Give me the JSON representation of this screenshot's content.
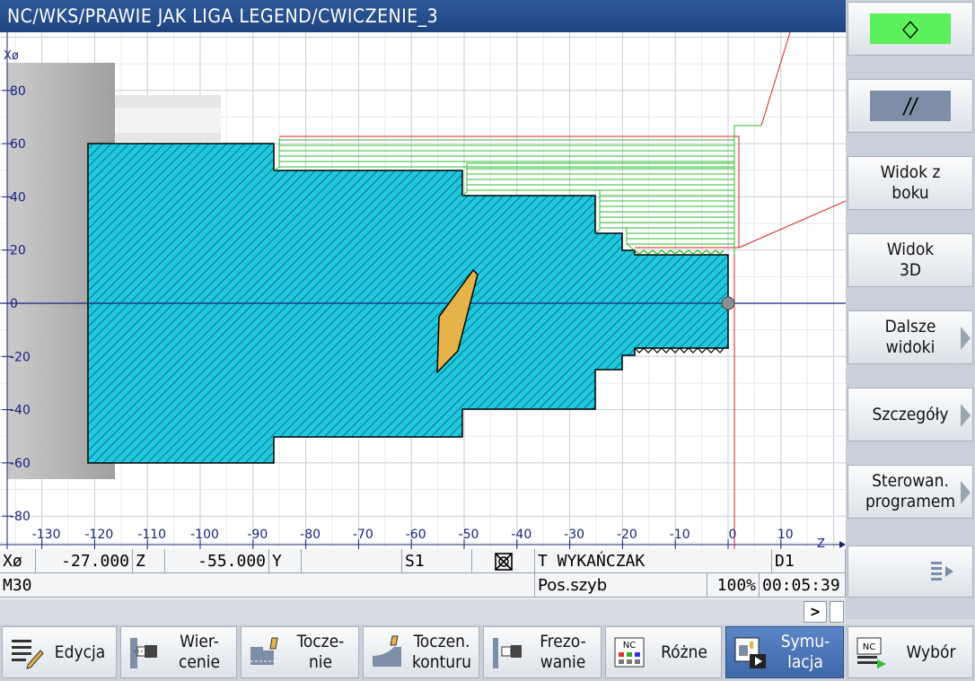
{
  "title": "NC/WKS/PRAWIE JAK LIGA LEGEND/CWICZENIE_3",
  "axis": {
    "x_axis_label": "Xø",
    "z_axis_label": "Z",
    "z_ticks": [
      -130,
      -120,
      -110,
      -100,
      -90,
      -80,
      -70,
      -60,
      -50,
      -40,
      -30,
      -20,
      -10,
      0,
      10
    ],
    "x_ticks": [
      80,
      60,
      40,
      20,
      0,
      -20,
      -40,
      -60,
      -80
    ]
  },
  "softkeys_right": {
    "cycle_start_symbol": "◇",
    "single_block_symbol": "//",
    "side_view": "Widok z boku",
    "view_3d": "Widok 3D",
    "more_views": "Dalsze widoki",
    "details": "Szczegóły",
    "program_control": "Sterowan. programem"
  },
  "status": {
    "x_label": "Xø",
    "x_value": "-27.000",
    "z_label": "Z",
    "z_value": "-55.000",
    "y_label": "Y",
    "spindle": "S1",
    "tool": "T WYKAŃCZAK",
    "offset": "D1",
    "program_end": "M30",
    "feed_label": "Pos.szyb",
    "override": "100%",
    "time": "00:05:39"
  },
  "nav": {
    "next": ">"
  },
  "softkeys_bottom": {
    "edit": "Edycja",
    "drilling": "Wier-\ncenie",
    "turning": "Tocze-\nnie",
    "contour_turning": "Toczen.\nkonturu",
    "milling": "Frezo-\nwanie",
    "misc": "Różne",
    "simulation": "Symu-\nlacja",
    "select": "Wybór"
  },
  "colors": {
    "part_fill": "#1ec9e0",
    "tool_fill": "#e6b24a",
    "path_green": "#2fbf2f",
    "path_red": "#e02020",
    "cycle_button": "#5cf05c",
    "title_bar": "#2a4f8f"
  }
}
